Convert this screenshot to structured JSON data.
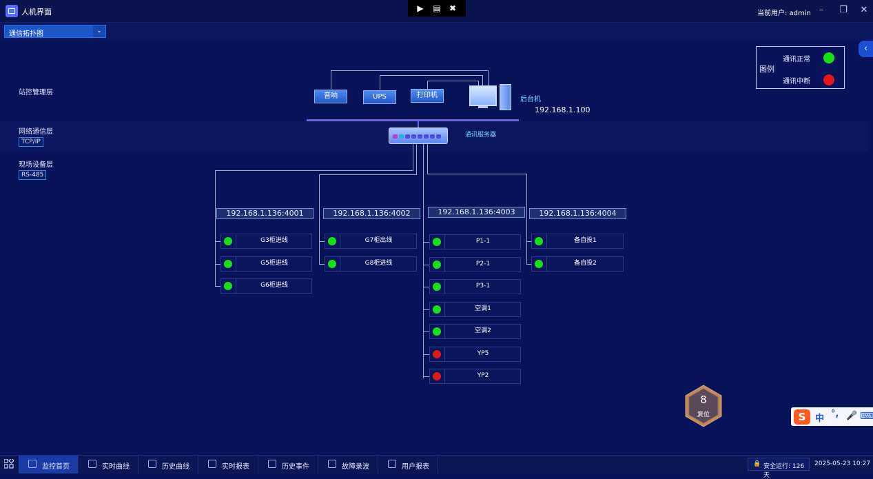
{
  "app": {
    "title": "人机界面",
    "user_label": "当前用户:  admin"
  },
  "toolbar": {
    "view_select": "通信拓扑图"
  },
  "layers": {
    "station": "站控管理层",
    "network": "网络通信层",
    "network_tag": "TCP/IP",
    "field": "现场设备层",
    "field_tag": "RS-485"
  },
  "legend": {
    "title": "图例",
    "normal": "通讯正常",
    "broken": "通讯中断",
    "normal_color": "#17e017",
    "broken_color": "#e01818"
  },
  "top_devices": {
    "alarm": "音响",
    "ups": "UPS",
    "printer": "打印机",
    "host_label": "后台机",
    "host_ip": "192.168.1.100"
  },
  "comm_server": "通讯服务器",
  "ports": [
    {
      "address": "192.168.1.136:4001",
      "devices": [
        {
          "name": "G3柜进线",
          "status": "normal"
        },
        {
          "name": "G5柜进线",
          "status": "normal"
        },
        {
          "name": "G6柜进线",
          "status": "normal"
        }
      ]
    },
    {
      "address": "192.168.1.136:4002",
      "devices": [
        {
          "name": "G7柜出线",
          "status": "normal"
        },
        {
          "name": "G8柜进线",
          "status": "normal"
        }
      ]
    },
    {
      "address": "192.168.1.136:4003",
      "devices": [
        {
          "name": "P1-1",
          "status": "normal"
        },
        {
          "name": "P2-1",
          "status": "normal"
        },
        {
          "name": "P3-1",
          "status": "normal"
        },
        {
          "name": "空调1",
          "status": "normal"
        },
        {
          "name": "空调2",
          "status": "normal"
        },
        {
          "name": "YP5",
          "status": "broken"
        },
        {
          "name": "YP2",
          "status": "broken"
        }
      ]
    },
    {
      "address": "192.168.1.136:4004",
      "devices": [
        {
          "name": "备自投1",
          "status": "normal"
        },
        {
          "name": "备自投2",
          "status": "normal"
        }
      ]
    }
  ],
  "reset": {
    "count": "8",
    "label": "复位"
  },
  "ime": {
    "logo": "S",
    "lang": "中",
    "punct": "°,",
    "mic_icon": "mic-icon",
    "keyboard_icon": "keyboard-icon"
  },
  "taskbar": {
    "items": [
      "监控首页",
      "实时曲线",
      "历史曲线",
      "实时报表",
      "历史事件",
      "故障录波",
      "用户报表"
    ],
    "status": "安全运行: 126 天",
    "datetime": "2025-05-23 10:27"
  }
}
